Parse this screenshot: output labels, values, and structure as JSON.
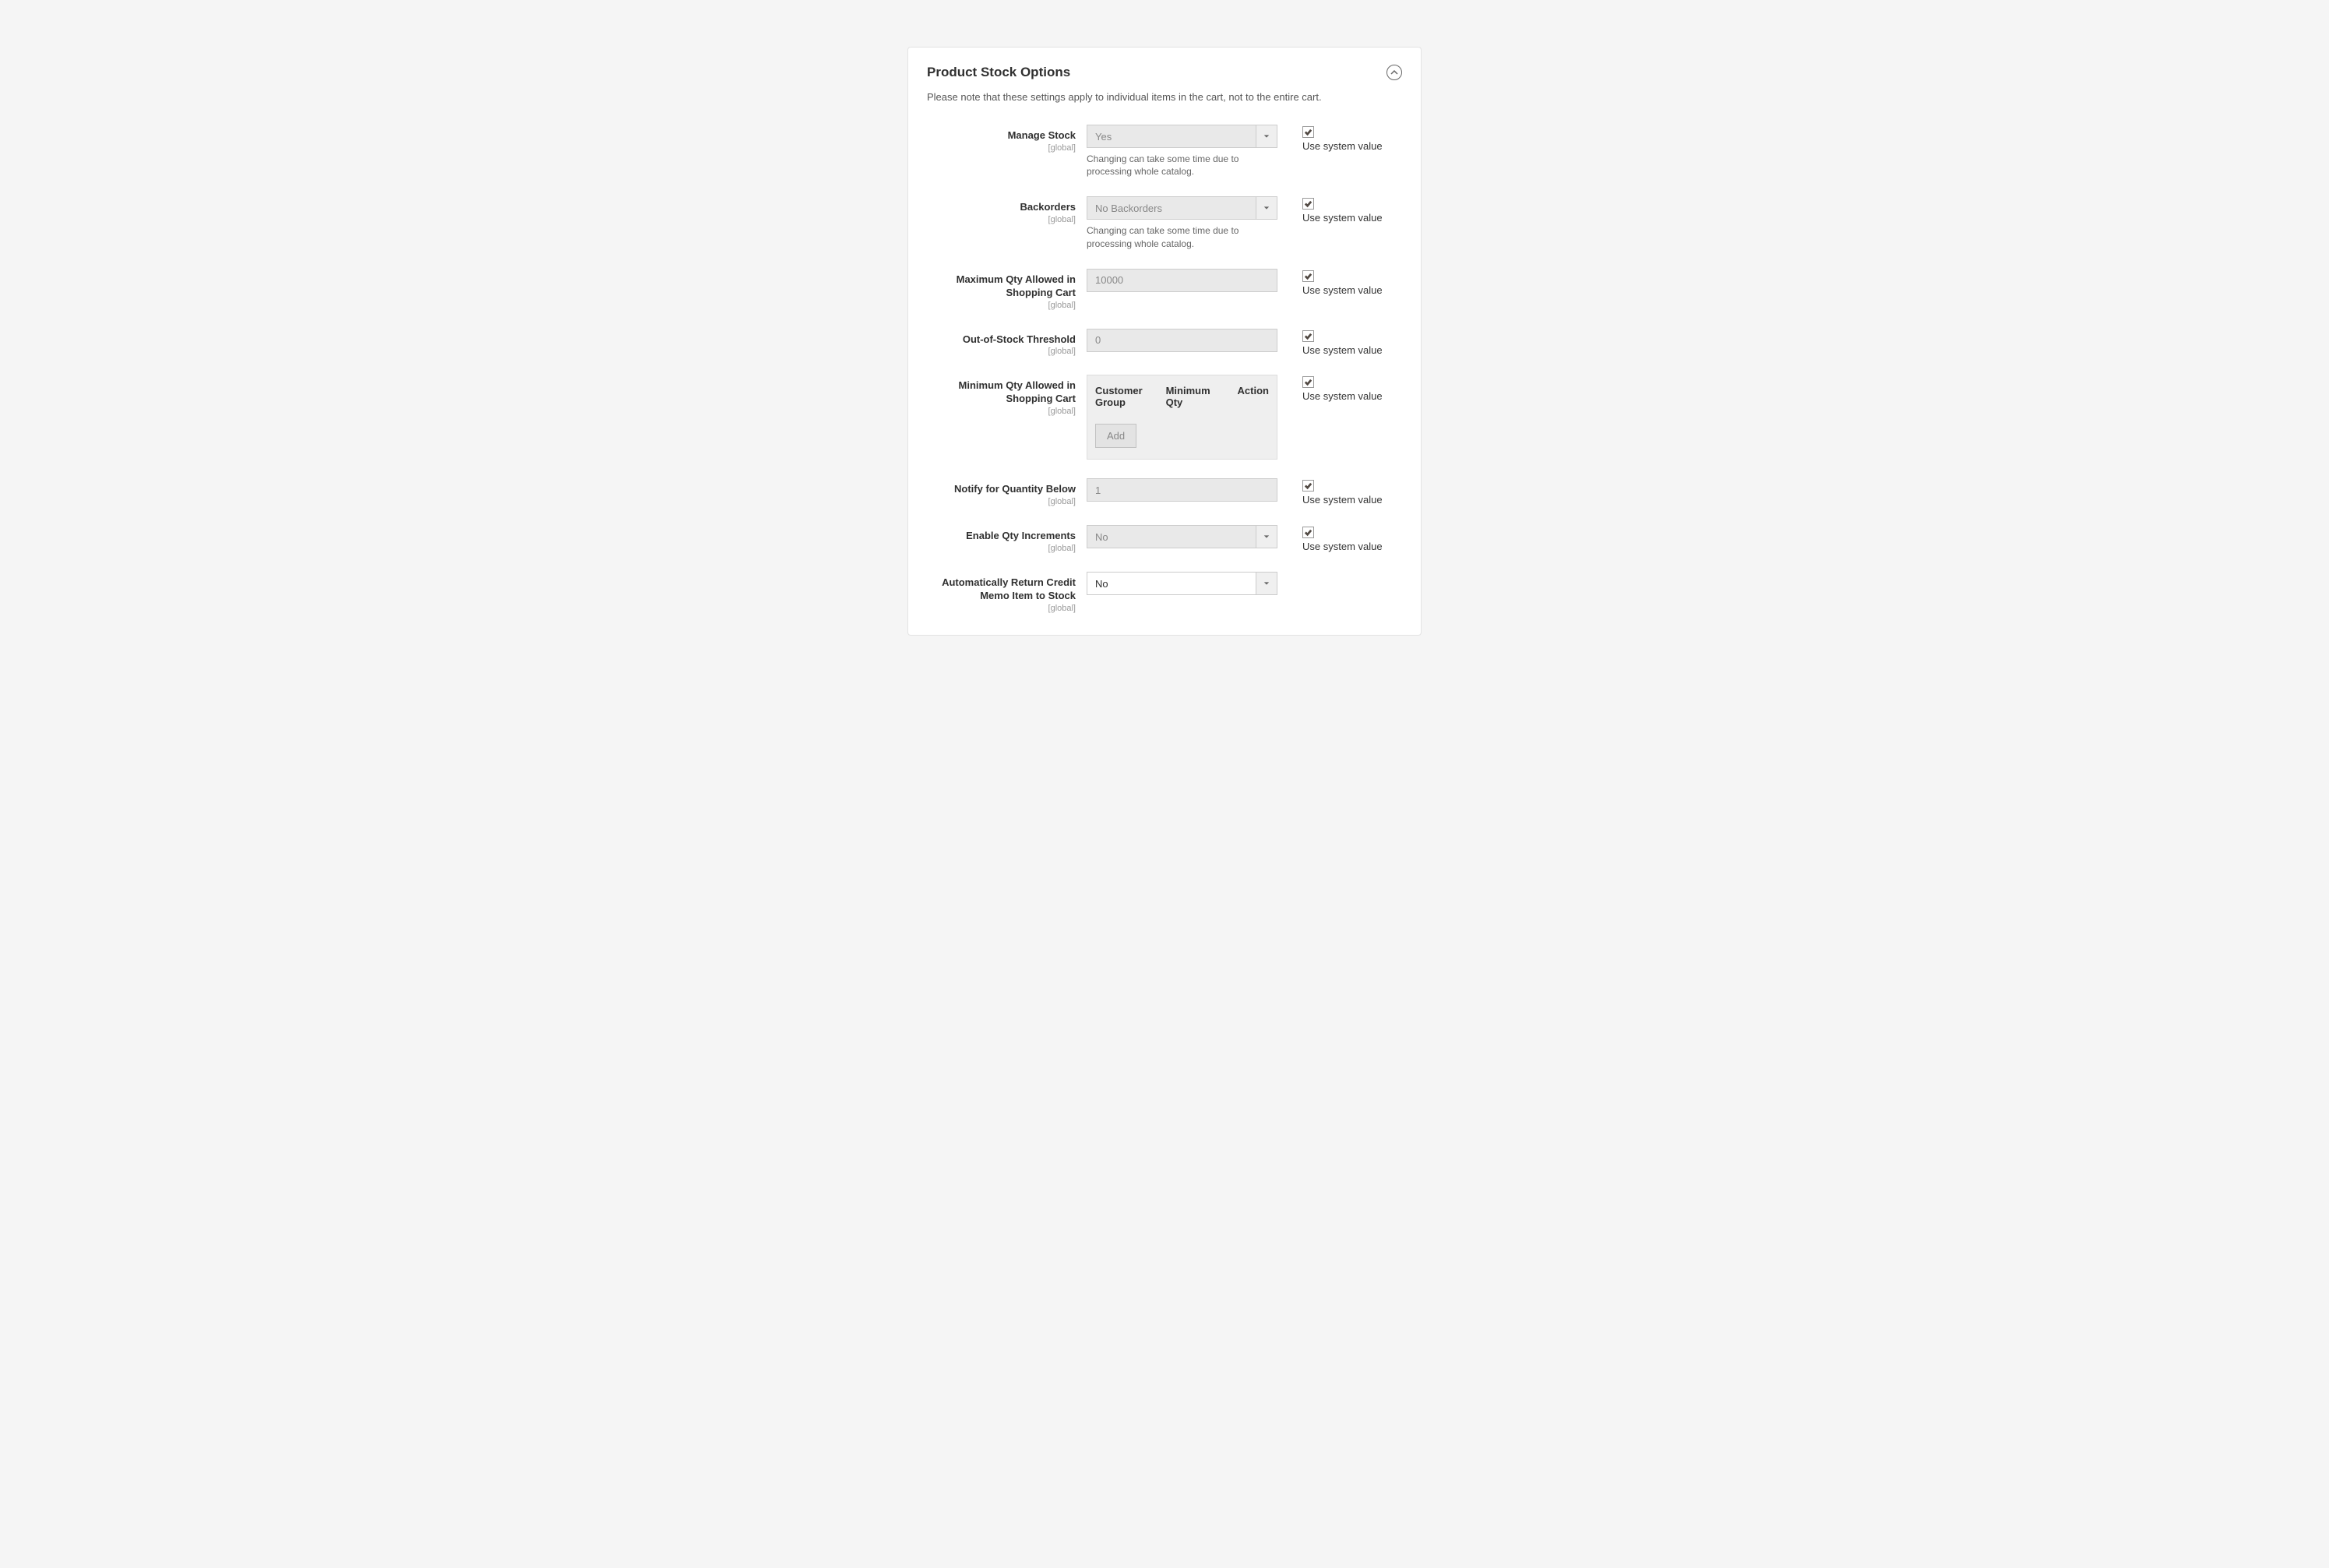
{
  "panel": {
    "title": "Product Stock Options",
    "note": "Please note that these settings apply to individual items in the cart, not to the entire cart.",
    "scope_label": "[global]",
    "use_system_value": "Use system value",
    "hint_catalog": "Changing can take some time due to processing whole catalog."
  },
  "fields": {
    "manage_stock": {
      "label": "Manage Stock",
      "value": "Yes"
    },
    "backorders": {
      "label": "Backorders",
      "value": "No Backorders"
    },
    "max_qty": {
      "label": "Maximum Qty Allowed in Shopping Cart",
      "value": "10000"
    },
    "out_of_stock": {
      "label": "Out-of-Stock Threshold",
      "value": "0"
    },
    "min_qty": {
      "label": "Minimum Qty Allowed in Shopping Cart",
      "cols": {
        "group": "Customer Group",
        "qty": "Minimum Qty",
        "action": "Action"
      },
      "add": "Add"
    },
    "notify": {
      "label": "Notify for Quantity Below",
      "value": "1"
    },
    "qty_inc": {
      "label": "Enable Qty Increments",
      "value": "No"
    },
    "return_credit": {
      "label": "Automatically Return Credit Memo Item to Stock",
      "value": "No"
    }
  }
}
